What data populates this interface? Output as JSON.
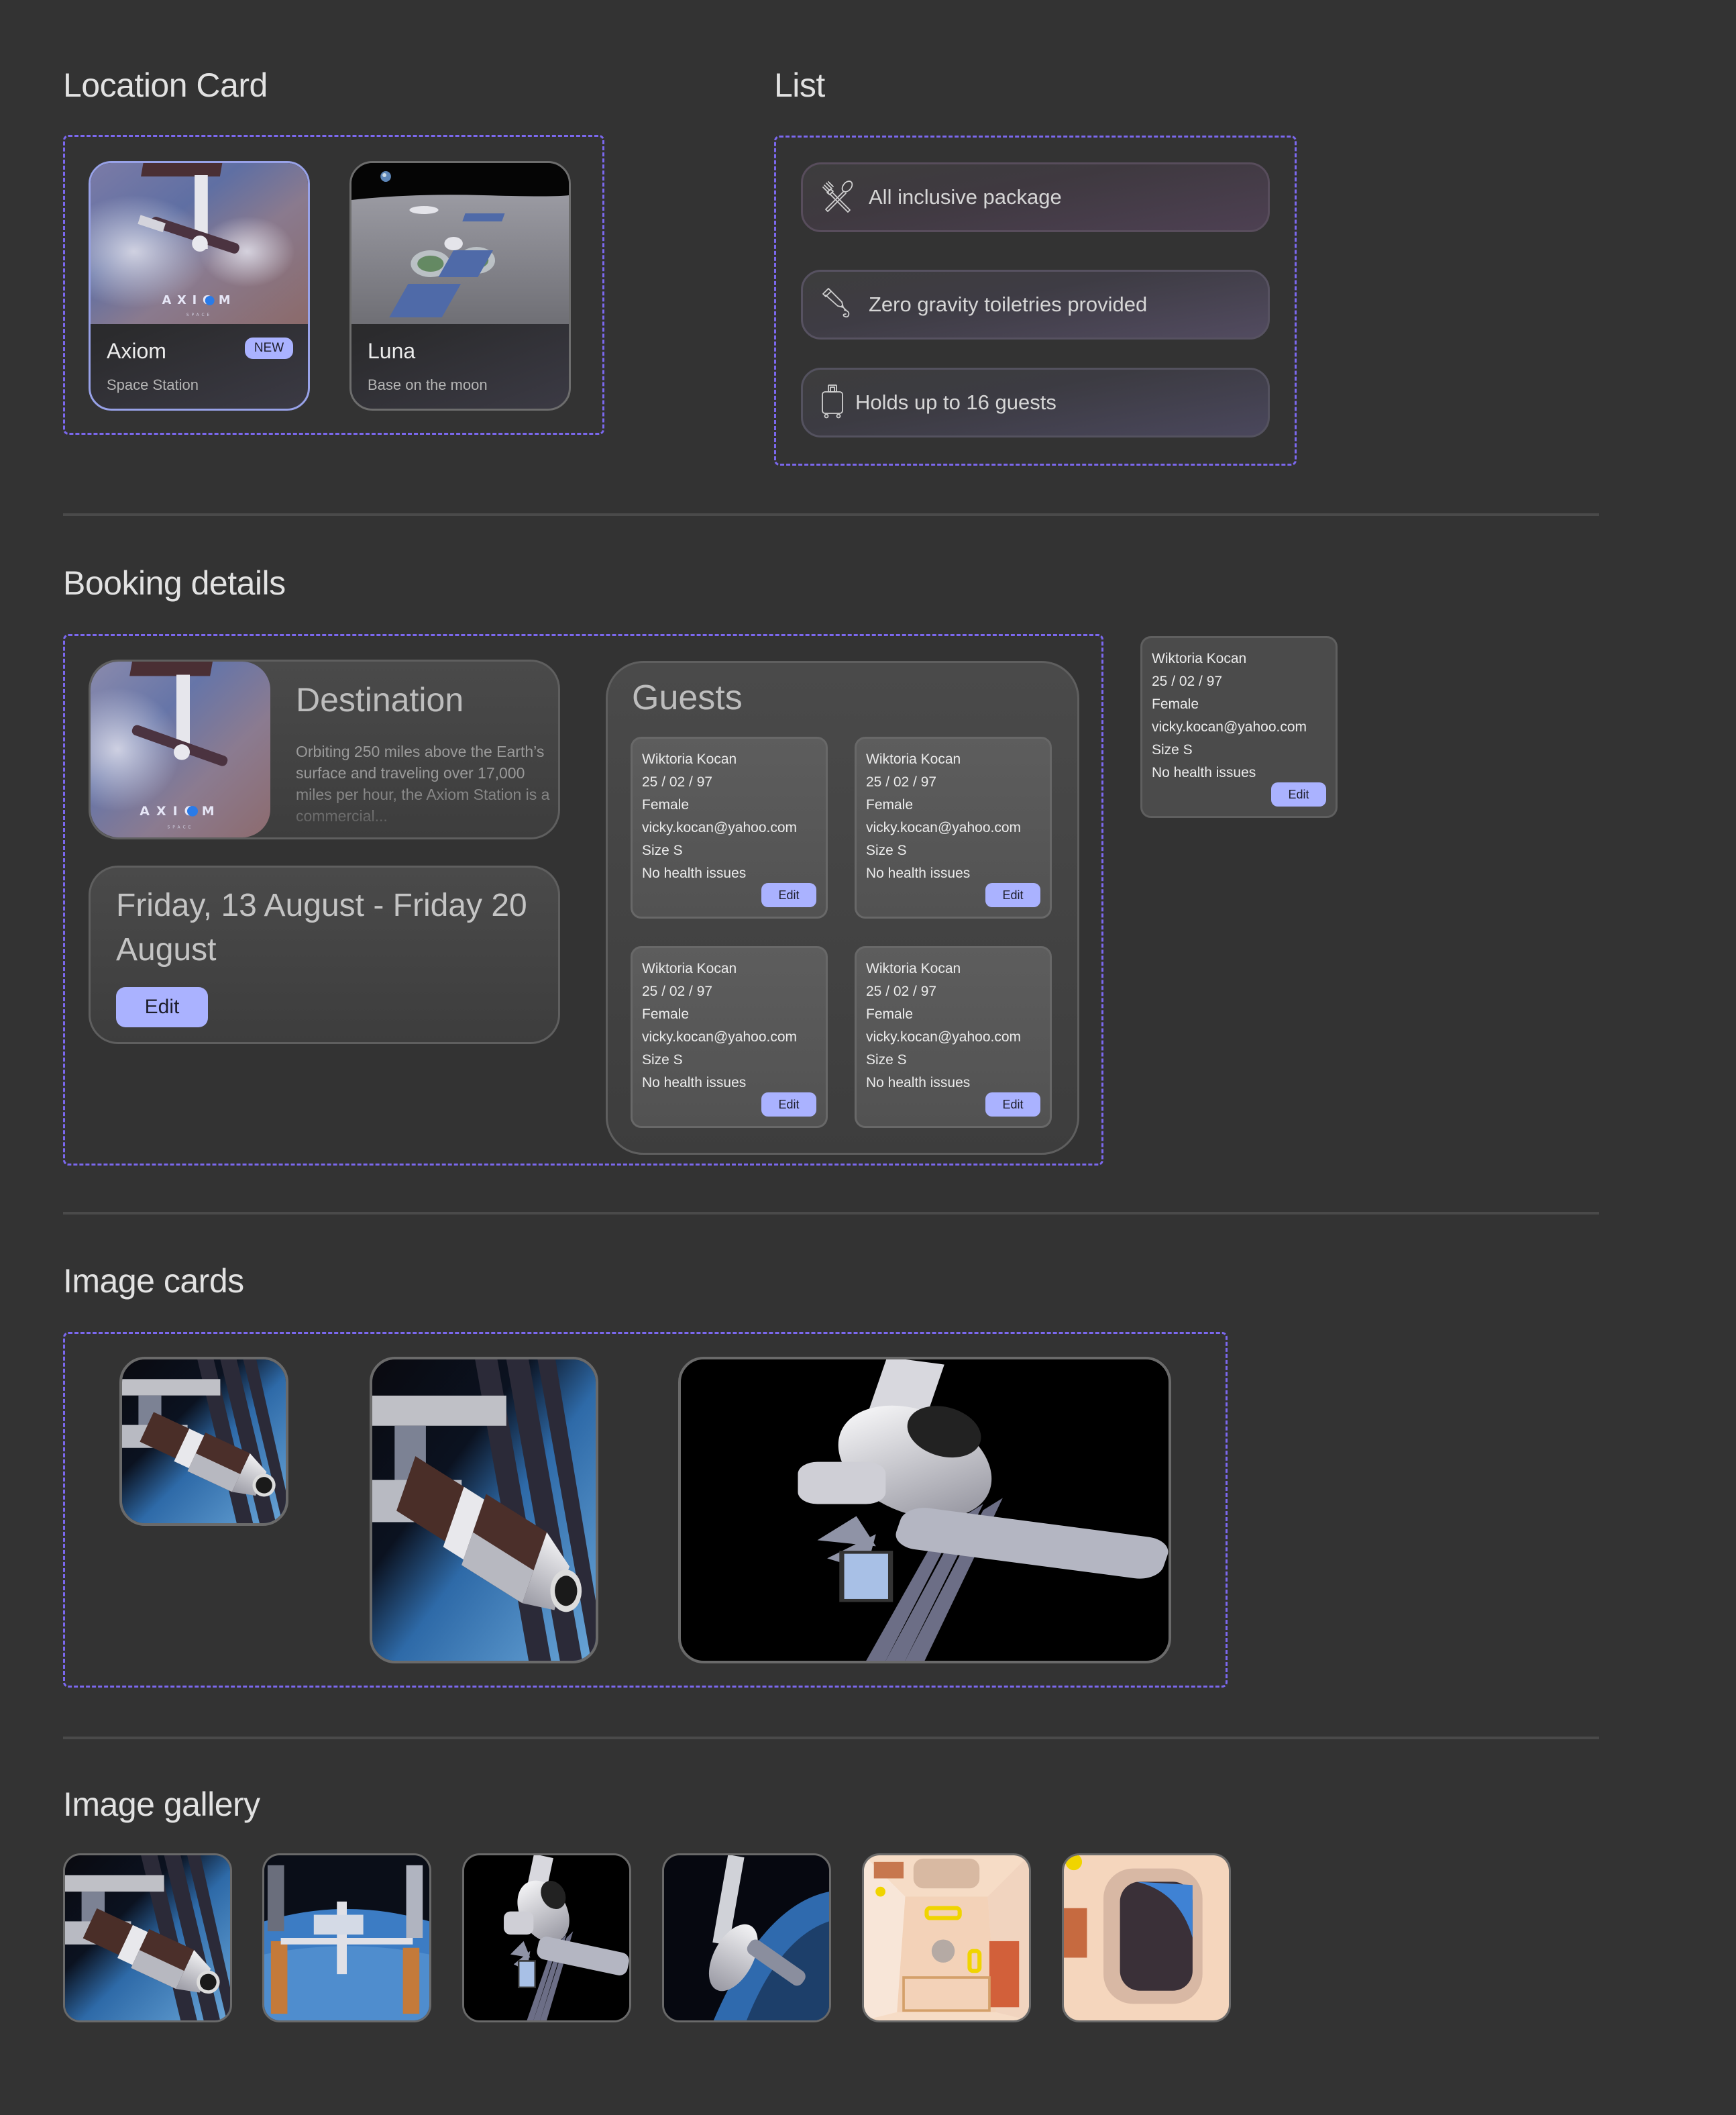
{
  "sections": {
    "location_card": "Location Card",
    "list": "List",
    "booking_details": "Booking details",
    "image_cards": "Image cards",
    "image_gallery": "Image gallery"
  },
  "location_cards": [
    {
      "title": "Axiom",
      "subtitle": "Space Station",
      "badge": "NEW",
      "image": "axiom-station-over-earth",
      "selected": true,
      "logo_text": "A X I O M",
      "logo_sub": "SPACE"
    },
    {
      "title": "Luna",
      "subtitle": "Base on the moon",
      "image": "lunar-base-with-domes",
      "selected": false
    }
  ],
  "list_items": [
    {
      "icon": "fork-spoon-icon",
      "label": "All inclusive package"
    },
    {
      "icon": "toothpaste-tube-icon",
      "label": "Zero gravity toiletries provided"
    },
    {
      "icon": "luggage-icon",
      "label": "Holds up to 16 guests"
    }
  ],
  "booking": {
    "destination": {
      "title": "Destination",
      "description": "Orbiting 250 miles above the Earth’s surface and traveling over 17,000 miles per hour, the Axiom Station is a commercial...",
      "image": "axiom-station-over-earth",
      "logo_text": "A X I O M",
      "logo_sub": "SPACE"
    },
    "dates": {
      "text": "Friday, 13 August - Friday 20 August",
      "edit_label": "Edit"
    },
    "guests": {
      "title": "Guests",
      "items": [
        {
          "name": "Wiktoria Kocan",
          "dob": "25 / 02 / 97",
          "gender": "Female",
          "email": "vicky.kocan@yahoo.com",
          "size": "Size S",
          "health": "No health issues",
          "edit_label": "Edit"
        },
        {
          "name": "Wiktoria Kocan",
          "dob": "25 / 02 / 97",
          "gender": "Female",
          "email": "vicky.kocan@yahoo.com",
          "size": "Size S",
          "health": "No health issues",
          "edit_label": "Edit"
        },
        {
          "name": "Wiktoria Kocan",
          "dob": "25 / 02 / 97",
          "gender": "Female",
          "email": "vicky.kocan@yahoo.com",
          "size": "Size S",
          "health": "No health issues",
          "edit_label": "Edit"
        },
        {
          "name": "Wiktoria Kocan",
          "dob": "25 / 02 / 97",
          "gender": "Female",
          "email": "vicky.kocan@yahoo.com",
          "size": "Size S",
          "health": "No health issues",
          "edit_label": "Edit"
        }
      ]
    },
    "guest_card_standalone": {
      "name": "Wiktoria Kocan",
      "dob": "25 / 02 / 97",
      "gender": "Female",
      "email": "vicky.kocan@yahoo.com",
      "size": "Size S",
      "health": "No health issues",
      "edit_label": "Edit"
    }
  },
  "image_cards": [
    {
      "image": "axiom-module-over-earth",
      "size": "small"
    },
    {
      "image": "axiom-module-over-earth",
      "size": "tall"
    },
    {
      "image": "axiom-station-black-space",
      "size": "large"
    }
  ],
  "gallery": [
    {
      "image": "axiom-module-over-earth"
    },
    {
      "image": "iss-over-earth"
    },
    {
      "image": "axiom-station-black-space"
    },
    {
      "image": "axiom-station-earth-horizon"
    },
    {
      "image": "padded-interior-module"
    },
    {
      "image": "interior-window-view"
    }
  ],
  "colors": {
    "background": "#333333",
    "accent": "#aab2ff",
    "dashed_outline": "#7b68ee",
    "selected_card_border": "#98a2e8"
  }
}
